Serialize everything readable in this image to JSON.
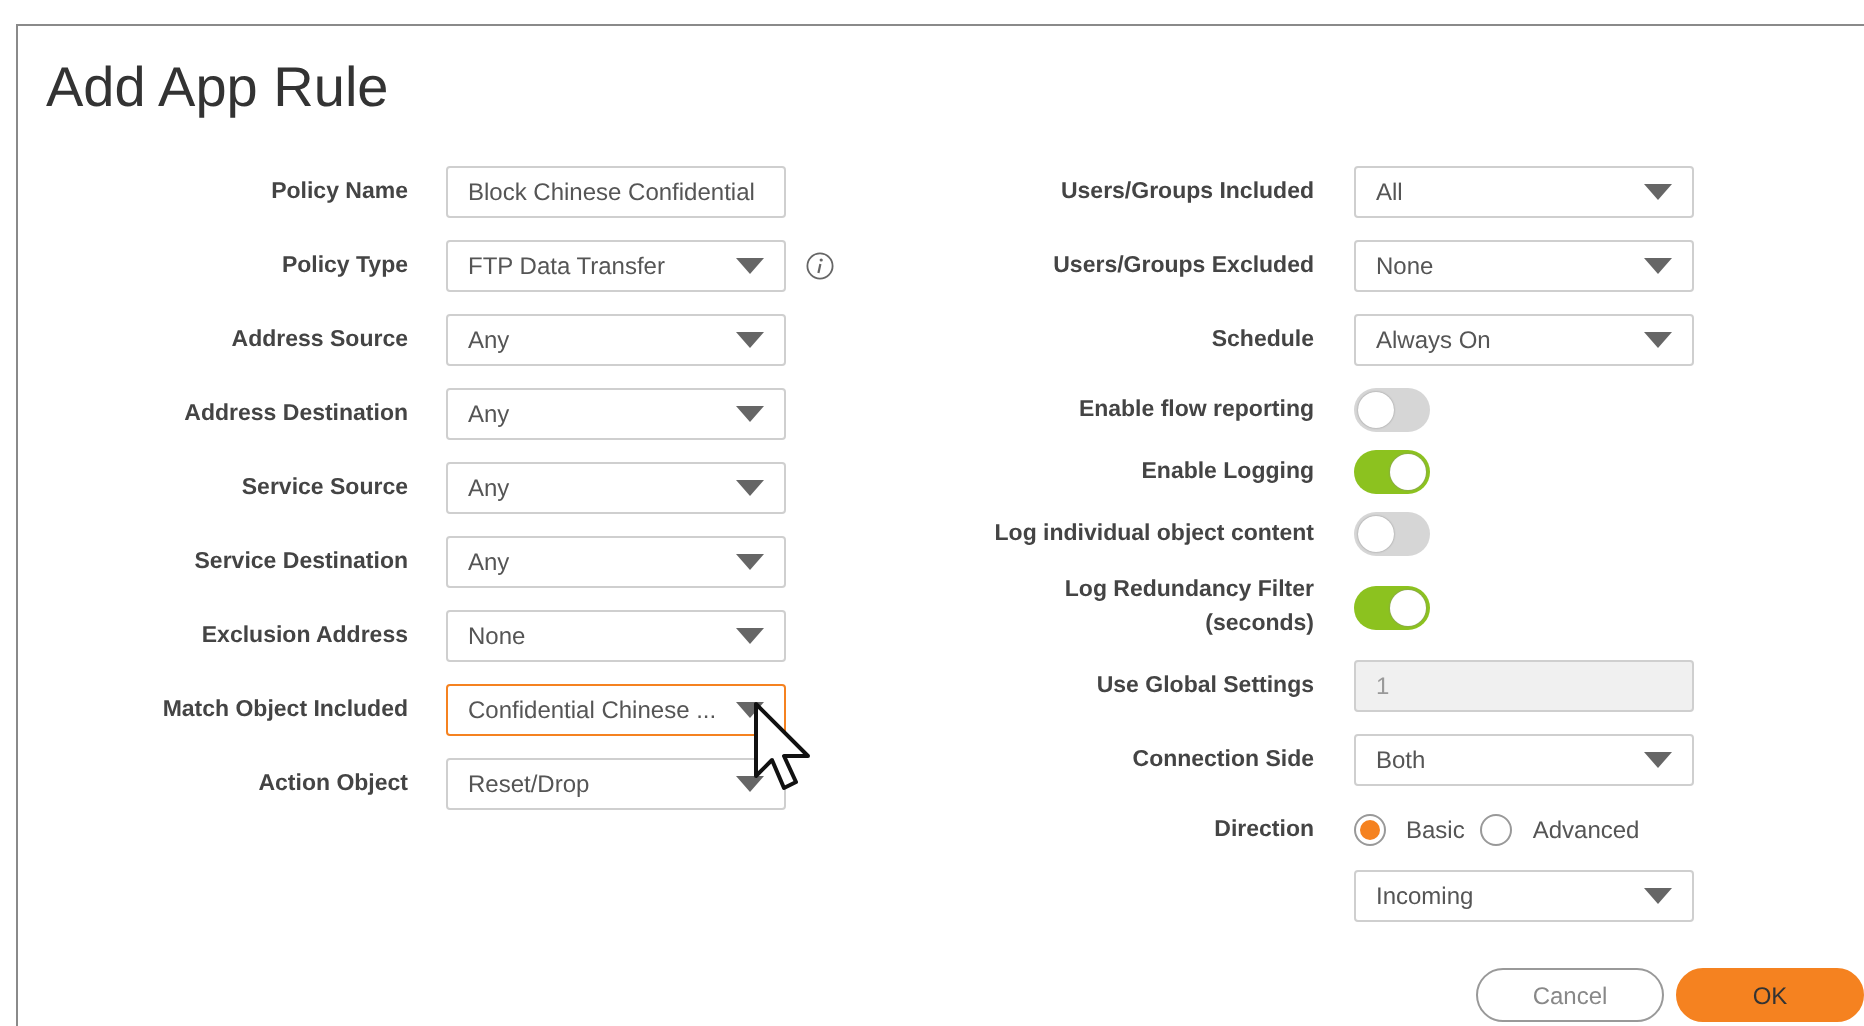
{
  "dialog": {
    "title": "Add App Rule"
  },
  "left_fields": [
    {
      "label": "Policy Name",
      "kind": "text",
      "value": "Block Chinese Confidential",
      "focused": false,
      "info": false
    },
    {
      "label": "Policy Type",
      "kind": "select",
      "value": "FTP Data Transfer",
      "focused": false,
      "info": true
    },
    {
      "label": "Address Source",
      "kind": "select",
      "value": "Any",
      "focused": false,
      "info": false
    },
    {
      "label": "Address Destination",
      "kind": "select",
      "value": "Any",
      "focused": false,
      "info": false
    },
    {
      "label": "Service Source",
      "kind": "select",
      "value": "Any",
      "focused": false,
      "info": false
    },
    {
      "label": "Service Destination",
      "kind": "select",
      "value": "Any",
      "focused": false,
      "info": false
    },
    {
      "label": "Exclusion Address",
      "kind": "select",
      "value": "None",
      "focused": false,
      "info": false
    },
    {
      "label": "Match Object Included",
      "kind": "select",
      "value": "Confidential Chinese ...",
      "focused": true,
      "info": false
    },
    {
      "label": "Action Object",
      "kind": "select",
      "value": "Reset/Drop",
      "focused": false,
      "info": false
    }
  ],
  "right_fields": [
    {
      "label": "Users/Groups Included",
      "kind": "select",
      "value": "All"
    },
    {
      "label": "Users/Groups Excluded",
      "kind": "select",
      "value": "None"
    },
    {
      "label": "Schedule",
      "kind": "select",
      "value": "Always On"
    },
    {
      "label": "Enable flow reporting",
      "kind": "toggle",
      "on": false
    },
    {
      "label": "Enable Logging",
      "kind": "toggle",
      "on": true
    },
    {
      "label": "Log individual object content",
      "kind": "toggle",
      "on": false
    },
    {
      "label": "Log Redundancy Filter (seconds)",
      "kind": "toggle",
      "on": true
    },
    {
      "label": "Use Global Settings",
      "kind": "text",
      "value": "1",
      "disabled": true
    },
    {
      "label": "Connection Side",
      "kind": "select",
      "value": "Both"
    },
    {
      "label": "Direction",
      "kind": "radio",
      "options": [
        {
          "label": "Basic",
          "selected": true
        },
        {
          "label": "Advanced",
          "selected": false
        }
      ]
    },
    {
      "kind": "select",
      "value": "Incoming"
    }
  ],
  "buttons": [
    {
      "label": "Cancel",
      "kind": "secondary"
    },
    {
      "label": "OK",
      "kind": "primary"
    }
  ]
}
